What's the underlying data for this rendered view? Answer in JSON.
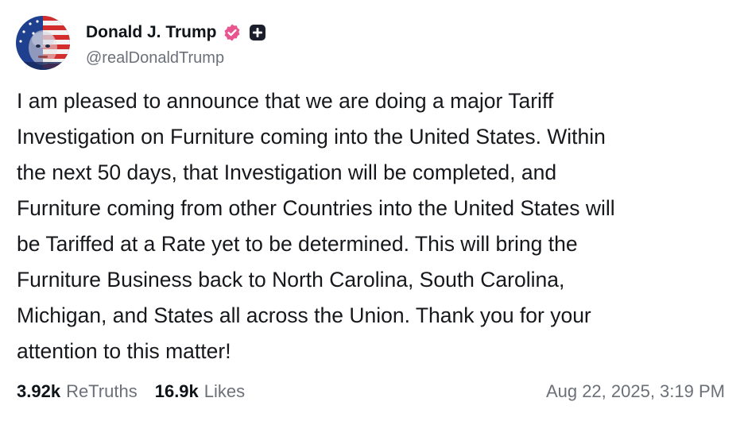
{
  "author": {
    "display_name": "Donald J. Trump",
    "handle": "@realDonaldTrump",
    "avatar": "flag-portrait-avatar",
    "verified_icon": "verified-badge-icon",
    "extra_icon": "plus-badge-icon",
    "verified_color": "#e8558f"
  },
  "post": {
    "text": "I am pleased to announce that we are doing a major Tariff\nInvestigation on Furniture coming into the United States. Within\nthe next 50 days, that Investigation will be completed, and\nFurniture coming from other Countries into the United States will\nbe Tariffed at a Rate yet to be determined. This will bring the\nFurniture Business back to North Carolina, South Carolina,\nMichigan, and States all across the Union. Thank you for your\nattention to this matter!"
  },
  "stats": {
    "retruths_count": "3.92k",
    "retruths_label": "ReTruths",
    "likes_count": "16.9k",
    "likes_label": "Likes"
  },
  "timestamp": "Aug 22, 2025, 3:19 PM"
}
